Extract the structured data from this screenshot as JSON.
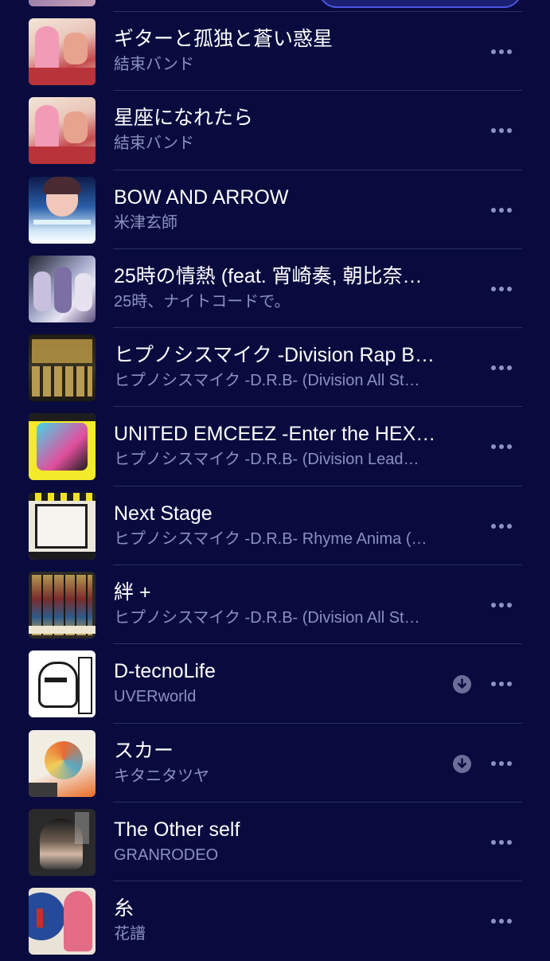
{
  "more_icon": "more-horizontal-icon",
  "download_icon": "downloaded-arrow-circle-icon",
  "colors": {
    "background": "#090b3f",
    "title": "#ffffff",
    "subtitle": "#8c90bd",
    "icon": "#8e93c2",
    "divider": "#2b2f62"
  },
  "songs": [
    {
      "title": "ギターと孤独と蒼い惑星",
      "artist": "結束バンド",
      "downloaded": false,
      "artwork": "kessoku-band-album"
    },
    {
      "title": "星座になれたら",
      "artist": "結束バンド",
      "downloaded": false,
      "artwork": "kessoku-band-album"
    },
    {
      "title": "BOW AND ARROW",
      "artist": "米津玄師",
      "downloaded": false,
      "artwork": "bow-and-arrow-single"
    },
    {
      "title": "25時の情熱 (feat. 宵崎奏, 朝比奈…",
      "artist": "25時、ナイトコードで。",
      "downloaded": false,
      "artwork": "25ji-album"
    },
    {
      "title": "ヒプノシスマイク -Division Rap B…",
      "artist": "ヒプノシスマイク -D.R.B- (Division All St…",
      "downloaded": false,
      "artwork": "hypmic-all-stars"
    },
    {
      "title": "UNITED EMCEEZ -Enter the HEX…",
      "artist": "ヒプノシスマイク -D.R.B- (Division Lead…",
      "downloaded": false,
      "artwork": "united-emceez"
    },
    {
      "title": "Next Stage",
      "artist": "ヒプノシスマイク -D.R.B- Rhyme Anima (…",
      "downloaded": false,
      "artwork": "next-stage"
    },
    {
      "title": "絆 +",
      "artist": "ヒプノシスマイク -D.R.B- (Division All St…",
      "downloaded": false,
      "artwork": "kizuna-plus"
    },
    {
      "title": "D-tecnoLife",
      "artist": "UVERworld",
      "downloaded": true,
      "artwork": "uverworld-timeless"
    },
    {
      "title": "スカー",
      "artist": "キタニタツヤ",
      "downloaded": true,
      "artwork": "scar-single"
    },
    {
      "title": "The Other self",
      "artist": "GRANRODEO",
      "downloaded": false,
      "artwork": "the-other-self"
    },
    {
      "title": "糸",
      "artist": "花譜",
      "downloaded": false,
      "artwork": "kaf-ito"
    }
  ]
}
